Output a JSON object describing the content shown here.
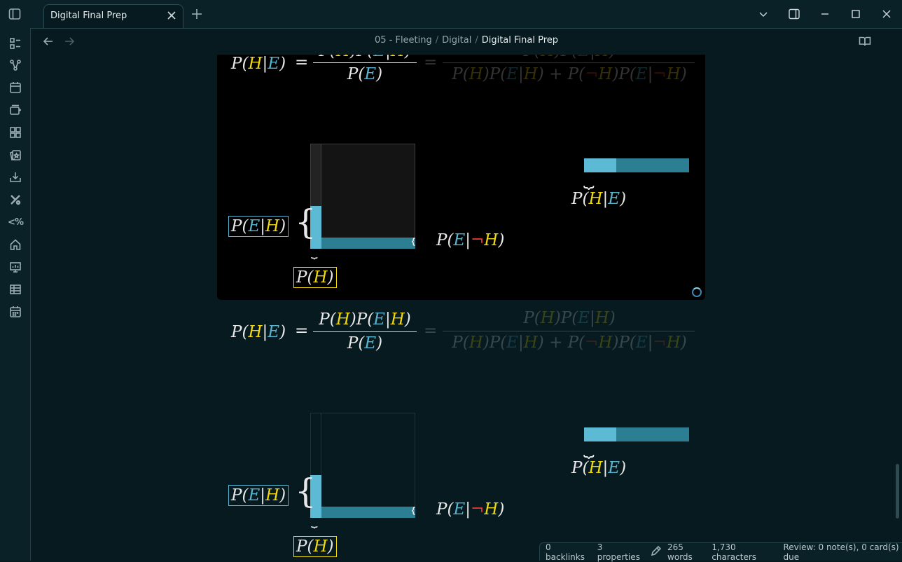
{
  "titlebar": {
    "tab_title": "Digital Final Prep"
  },
  "breadcrumb": {
    "items": [
      "05 - Fleeting",
      "Digital",
      "Digital Final Prep"
    ],
    "separator": "/"
  },
  "ribbon": {
    "items": [
      "files-icon",
      "graph-icon",
      "calendar-icon",
      "new-card-icon",
      "blocks-icon",
      "flashcards-icon",
      "import-icon",
      "tools-icon",
      "percent-icon",
      "home-icon",
      "slides-icon",
      "table-icon",
      "daily-calendar-icon"
    ],
    "percent_label": "<%"
  },
  "math": {
    "lhs": "P(H|E)",
    "equals": "=",
    "numerator": "P(H)P(E|H)",
    "denominator": "P(E)",
    "full_denominator": "P(H)P(E|H) + P(¬H)P(E|¬H)",
    "p_e_given_h": "P(E|H)",
    "p_e_given_not_h": "P(E|¬H)",
    "p_h": "P(H)",
    "p_h_given_e": "P(H|E)"
  },
  "status": {
    "backlinks": "0 backlinks",
    "properties": "3 properties",
    "words": "265 words",
    "characters": "1,730 characters",
    "review": "Review: 0 note(s), 0 card(s) due"
  },
  "colors": {
    "background": "#061a1f",
    "hypothesis": "#f2d90f",
    "evidence": "#58b4cf",
    "negation": "#e6362f"
  }
}
